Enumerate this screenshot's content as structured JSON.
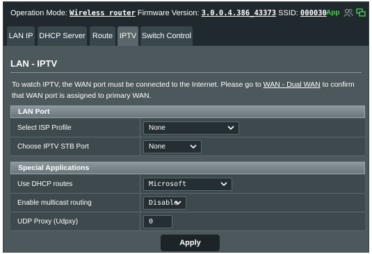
{
  "topbar": {
    "mode_label": "Operation Mode:",
    "mode_value": "Wireless router",
    "firmware_label": "Firmware Version:",
    "firmware_value": "3.0.0.4.386_43373",
    "ssid_label": "SSID:",
    "ssid_value": "000030",
    "app_label": "App",
    "accent_color": "#49d14d"
  },
  "tabs": [
    {
      "label": "LAN IP"
    },
    {
      "label": "DHCP Server"
    },
    {
      "label": "Route"
    },
    {
      "label": "IPTV",
      "active": true
    },
    {
      "label": "Switch Control"
    }
  ],
  "page": {
    "title": "LAN - IPTV",
    "desc_part1": "To watch IPTV, the WAN port must be connected to the Internet. Please go to ",
    "desc_link": "WAN - Dual WAN",
    "desc_part2": " to confirm that WAN port is assigned to primary WAN."
  },
  "lan_port": {
    "header": "LAN Port",
    "isp_profile_label": "Select ISP Profile",
    "isp_profile_value": "None",
    "stb_port_label": "Choose IPTV STB Port",
    "stb_port_value": "None"
  },
  "special_apps": {
    "header": "Special Applications",
    "dhcp_routes_label": "Use DHCP routes",
    "dhcp_routes_value": "Microsoft",
    "multicast_label": "Enable multicast routing",
    "multicast_value": "Disable",
    "udp_proxy_label": "UDP Proxy (Udpxy)",
    "udp_proxy_value": "0"
  },
  "apply_label": "Apply"
}
